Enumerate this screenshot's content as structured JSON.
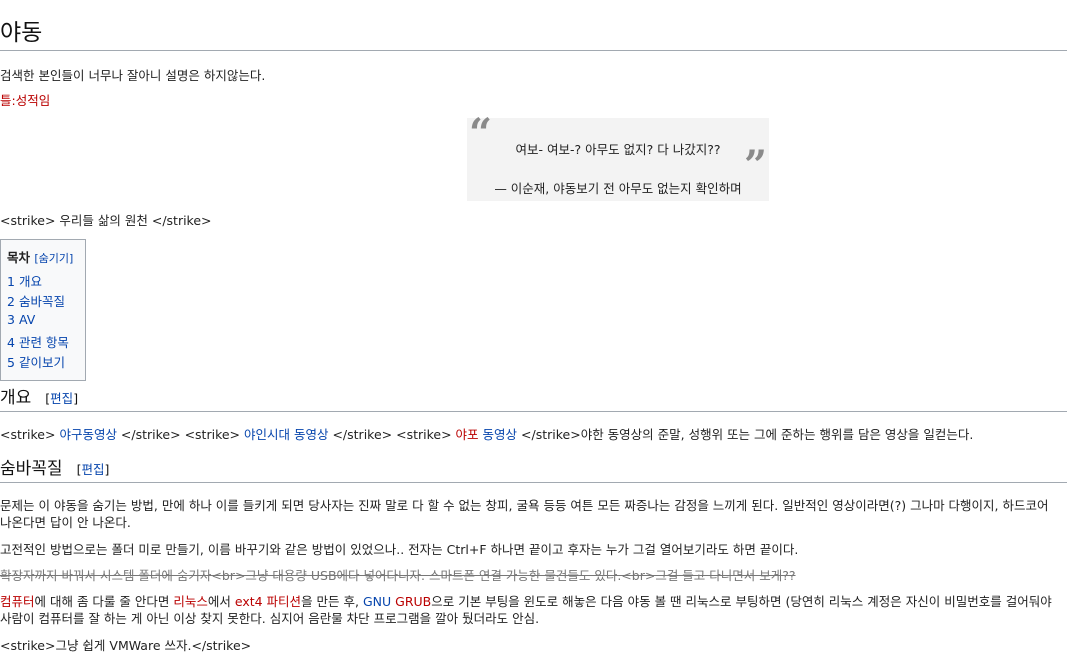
{
  "title": "야동",
  "intro": "검색한 본인들이 너무나 잘아니 설명은 하지않는다.",
  "template_link": "틀:성적임",
  "quote": {
    "open_mark": "“",
    "close_mark": "”",
    "text": "여보- 여보-? 아무도 없지? 다 나갔지??",
    "source": "— 이순재, 야동보기 전 아무도 없는지 확인하며"
  },
  "strike_line": "<strike> 우리들 삶의 원천 </strike>",
  "toc": {
    "title": "목차",
    "toggle": "[숨기기]",
    "items": [
      {
        "num": "1",
        "label": "개요"
      },
      {
        "num": "2",
        "label": "숨바꼭질"
      },
      {
        "num": "3",
        "label": "AV"
      },
      {
        "num": "4",
        "label": "관련 항목"
      },
      {
        "num": "5",
        "label": "같이보기"
      }
    ]
  },
  "section1": {
    "heading": "개요",
    "edit_open": "[",
    "edit": "편집",
    "edit_close": "]",
    "p_parts": [
      "<strike> ",
      "야구동영상",
      " </strike> <strike> ",
      "야인시대 동영상",
      " </strike> <strike> ",
      "야포",
      " ",
      "동영상",
      " </strike>야한 동영상의 준말, 성행위 또는 그에 준하는 행위를 담은 영상을 일컫는다."
    ]
  },
  "section2": {
    "heading": "숨바꼭질",
    "edit_open": "[",
    "edit": "편집",
    "edit_close": "]",
    "p1_a": "문제는 이 야동을 숨기는 방법, 만에 하나 이를 들키게 되면 당사자는 진짜 말로 다 할 수 없는 창피, 굴욕 등등 여튼 모든 짜증나는 감정을 느끼게 된다. 일반적인 영상이라면(?) 그나마 다행이지, 하드코어",
    "p1_b": "나온다면 답이 안 나온다.",
    "p2": "고전적인 방법으로는 폴더 미로 만들기, 이름 바꾸기와 같은 방법이 있었으나.. 전자는 Ctrl+F 하나면 끝이고 후자는 누가 그걸 열어보기라도 하면 끝이다.",
    "p3": "확장자까지 바꿔서 시스템 폴더에 숨기자<br>그냥 대용량 USB에다 넣어다니자. 스마트폰 연결 가능한 물건들도 있다.<br>그걸 들고 다니면서 보게??",
    "p4_parts": [
      "컴퓨터",
      "에 대해 좀 다룰 줄 안다면 ",
      "리눅스",
      "에서 ",
      "ext4 파티션",
      "을 만든 후, ",
      "GNU",
      " ",
      "GRUB",
      "으로 기본 부팅을 윈도로 해놓은 다음 야동 볼 땐 리눅스로 부팅하면 (당연히 리눅스 계정은 자신이 비밀번호를 걸어둬야"
    ],
    "p4_b": "사람이 컴퓨터를 잘 하는 게 아닌 이상 찾지 못한다. 심지어 음란물 차단 프로그램을 깔아 뒀더라도 안심.",
    "p5": "<strike>그냥 쉽게 VMWare 쓰자.</strike>"
  }
}
